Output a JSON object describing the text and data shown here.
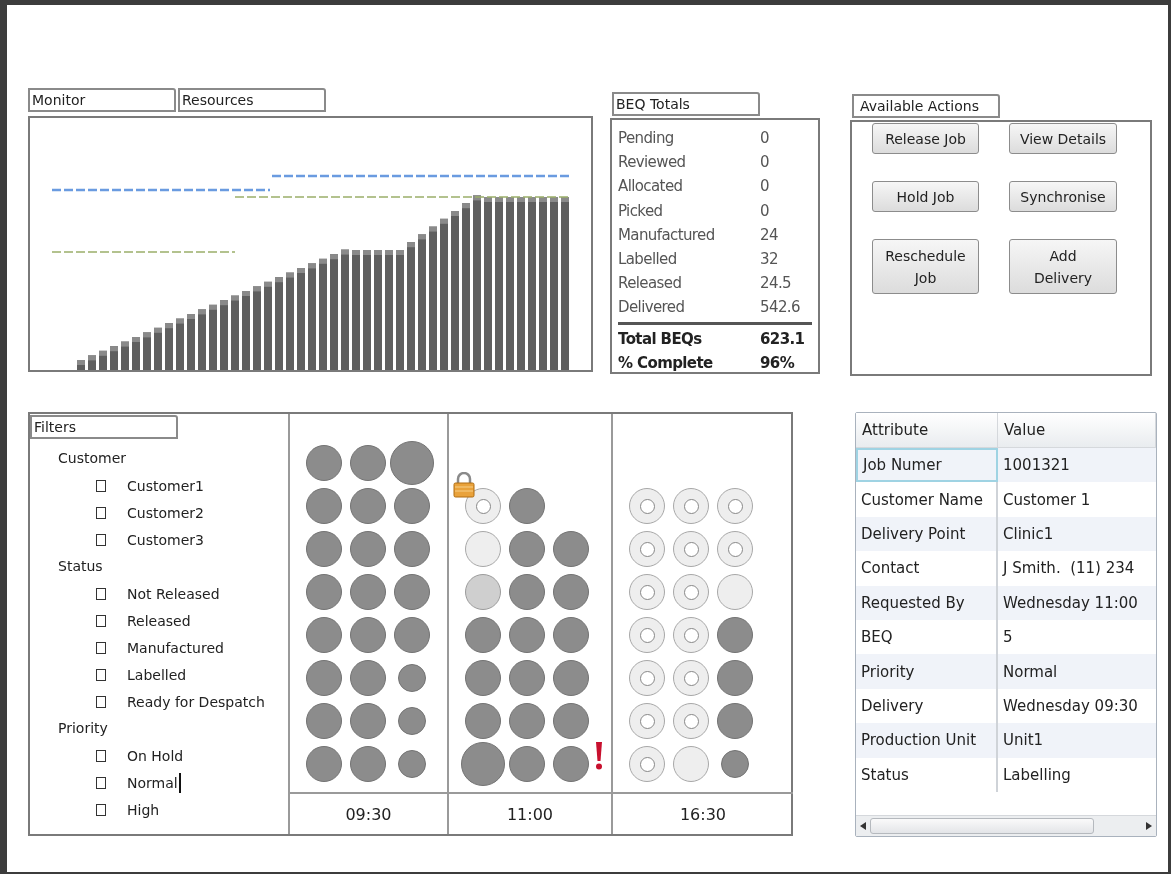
{
  "monitor": {
    "tabs": [
      {
        "label": "Monitor"
      },
      {
        "label": "Resources"
      }
    ]
  },
  "beq_totals": {
    "title": "BEQ Totals",
    "rows": [
      {
        "kind": "count",
        "label": "Pending",
        "value": "0"
      },
      {
        "kind": "count",
        "label": "Reviewed",
        "value": "0"
      },
      {
        "kind": "count",
        "label": "Allocated",
        "value": "0"
      },
      {
        "kind": "count",
        "label": "Picked",
        "value": "0"
      },
      {
        "kind": "count",
        "label": "Manufactured",
        "value": "24"
      },
      {
        "kind": "count",
        "label": "Labelled",
        "value": "32"
      },
      {
        "kind": "count",
        "label": "Released",
        "value": "24.5"
      },
      {
        "kind": "count",
        "label": "Delivered",
        "value": "542.6"
      },
      {
        "kind": "total",
        "label": "Total BEQs",
        "value": "623.1"
      },
      {
        "kind": "total",
        "label": "% Complete",
        "value": "96%"
      }
    ]
  },
  "actions": {
    "title": "Available Actions",
    "buttons": [
      {
        "lines": [
          "Release Job"
        ]
      },
      {
        "lines": [
          "View Details"
        ]
      },
      {
        "lines": [
          "Hold Job"
        ]
      },
      {
        "lines": [
          "Synchronise"
        ]
      },
      {
        "lines": [
          "Reschedule",
          "Job"
        ]
      },
      {
        "lines": [
          "Add",
          "Delivery"
        ]
      }
    ]
  },
  "filters": {
    "title": "Filters",
    "groups": [
      {
        "label": "Customer",
        "options": [
          {
            "label": "Customer1",
            "checked": false
          },
          {
            "label": "Customer2",
            "checked": false
          },
          {
            "label": "Customer3",
            "checked": false
          }
        ]
      },
      {
        "label": "Status",
        "options": [
          {
            "label": "Not Released",
            "checked": false
          },
          {
            "label": "Released",
            "checked": false
          },
          {
            "label": "Manufactured",
            "checked": false
          },
          {
            "label": "Labelled",
            "checked": false
          },
          {
            "label": "Ready for Despatch",
            "checked": false
          }
        ]
      },
      {
        "label": "Priority",
        "options": [
          {
            "label": "On Hold",
            "checked": false
          },
          {
            "label": "Normal",
            "checked": false,
            "caret": true
          },
          {
            "label": "High",
            "checked": false
          }
        ]
      }
    ]
  },
  "schedule": {
    "columns": [
      {
        "time": "09:30",
        "rows": [
          [
            {
              "kind": "filled"
            },
            {
              "kind": "filled"
            },
            {
              "kind": "big"
            }
          ],
          [
            {
              "kind": "filled"
            },
            {
              "kind": "filled"
            },
            {
              "kind": "filled"
            }
          ],
          [
            {
              "kind": "filled"
            },
            {
              "kind": "filled"
            },
            {
              "kind": "filled"
            }
          ],
          [
            {
              "kind": "filled"
            },
            {
              "kind": "filled"
            },
            {
              "kind": "filled"
            }
          ],
          [
            {
              "kind": "filled"
            },
            {
              "kind": "filled"
            },
            {
              "kind": "filled"
            }
          ],
          [
            {
              "kind": "filled"
            },
            {
              "kind": "filled"
            },
            {
              "kind": "small"
            }
          ],
          [
            {
              "kind": "filled"
            },
            {
              "kind": "filled"
            },
            {
              "kind": "small"
            }
          ],
          [
            {
              "kind": "filled"
            },
            {
              "kind": "filled"
            },
            {
              "kind": "small"
            }
          ]
        ]
      },
      {
        "time": "11:00",
        "rows": [
          [
            {
              "kind": "lockedring"
            },
            {
              "kind": "filled"
            }
          ],
          [
            {
              "kind": "light"
            },
            {
              "kind": "filled"
            },
            {
              "kind": "filled"
            }
          ],
          [
            {
              "kind": "grey"
            },
            {
              "kind": "filled"
            },
            {
              "kind": "filled"
            }
          ],
          [
            {
              "kind": "filled"
            },
            {
              "kind": "filled"
            },
            {
              "kind": "filled"
            }
          ],
          [
            {
              "kind": "filled"
            },
            {
              "kind": "filled"
            },
            {
              "kind": "filled"
            }
          ],
          [
            {
              "kind": "filled"
            },
            {
              "kind": "filled"
            },
            {
              "kind": "filled"
            }
          ],
          [
            {
              "kind": "big"
            },
            {
              "kind": "filled"
            },
            {
              "kind": "flagged"
            }
          ]
        ]
      },
      {
        "time": "16:30",
        "rows": [
          [
            {
              "kind": "ring"
            },
            {
              "kind": "ring"
            },
            {
              "kind": "ring"
            }
          ],
          [
            {
              "kind": "ring"
            },
            {
              "kind": "ring"
            },
            {
              "kind": "ring"
            }
          ],
          [
            {
              "kind": "ring"
            },
            {
              "kind": "ring"
            },
            {
              "kind": "light"
            }
          ],
          [
            {
              "kind": "ring"
            },
            {
              "kind": "ring"
            },
            {
              "kind": "filled"
            }
          ],
          [
            {
              "kind": "ring"
            },
            {
              "kind": "ring"
            },
            {
              "kind": "filled"
            }
          ],
          [
            {
              "kind": "ring"
            },
            {
              "kind": "ring"
            },
            {
              "kind": "filled"
            }
          ],
          [
            {
              "kind": "ring"
            },
            {
              "kind": "light"
            },
            {
              "kind": "small"
            }
          ]
        ]
      }
    ]
  },
  "details": {
    "columns": [
      "Attribute",
      "Value"
    ],
    "rows": [
      {
        "attribute": "Job Numer",
        "value": "1001321",
        "selected": true
      },
      {
        "attribute": "Customer Name",
        "value": "Customer 1",
        "selected": false
      },
      {
        "attribute": "Delivery Point",
        "value": "Clinic1",
        "selected": false
      },
      {
        "attribute": "Contact",
        "value": "J Smith.  (11) 234",
        "selected": false
      },
      {
        "attribute": "Requested By",
        "value": "Wednesday 11:00",
        "selected": false
      },
      {
        "attribute": "BEQ",
        "value": "5",
        "selected": false
      },
      {
        "attribute": "Priority",
        "value": "Normal",
        "selected": false
      },
      {
        "attribute": "Delivery",
        "value": "Wednesday 09:30",
        "selected": false
      },
      {
        "attribute": "Production Unit",
        "value": "Unit1",
        "selected": false
      },
      {
        "attribute": "Status",
        "value": "Labelling",
        "selected": false
      }
    ]
  }
}
